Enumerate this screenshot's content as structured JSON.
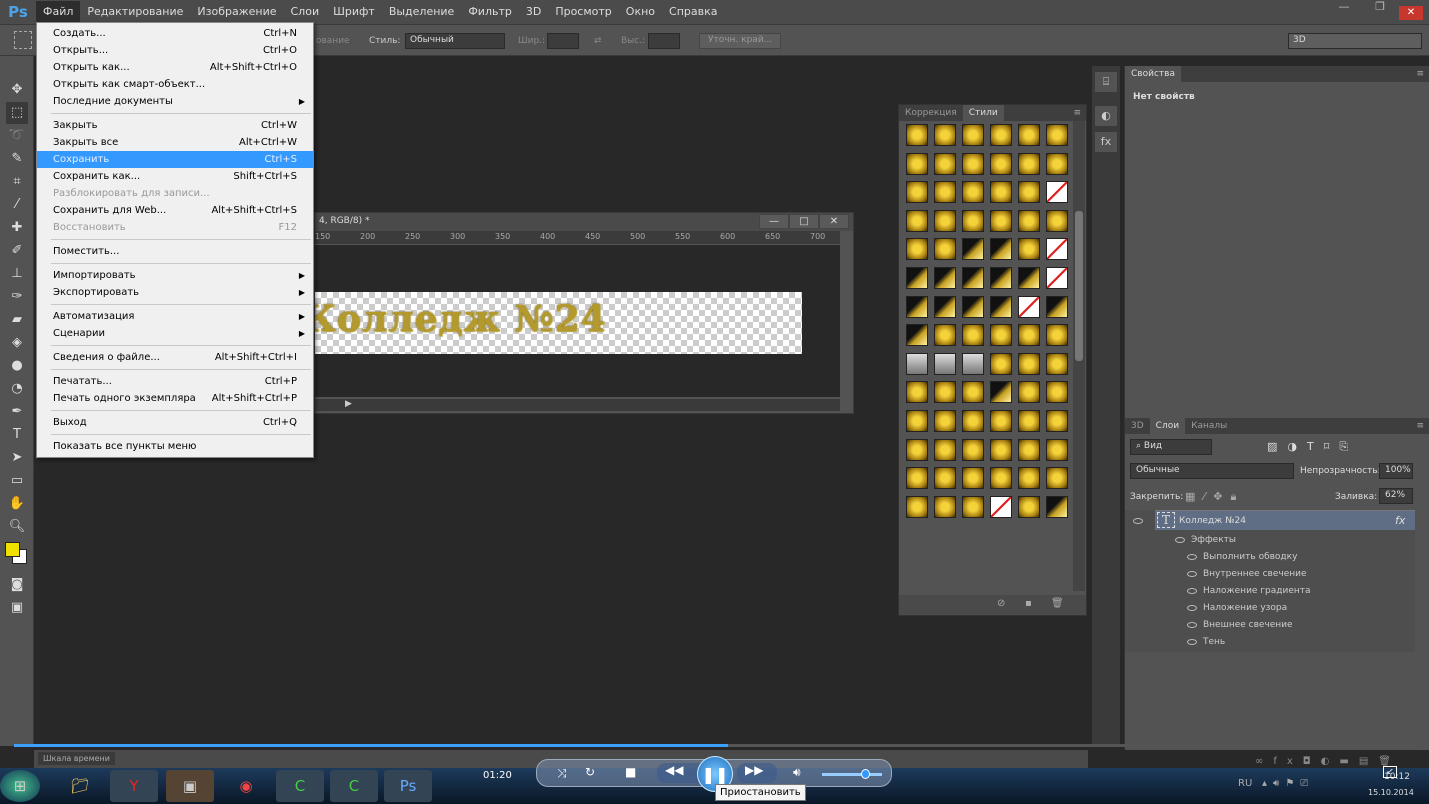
{
  "app": {
    "logo": "Ps"
  },
  "menubar": [
    "Файл",
    "Редактирование",
    "Изображение",
    "Слои",
    "Шрифт",
    "Выделение",
    "Фильтр",
    "3D",
    "Просмотр",
    "Окно",
    "Справка"
  ],
  "window_controls": {
    "minimize": "—",
    "restore": "❐",
    "close": "✕"
  },
  "options": {
    "mode_partial": "ование",
    "style_label": "Стиль:",
    "style_value": "Обычный",
    "width_label": "Шир.:",
    "height_label": "Выс.:",
    "refine_button": "Уточн. край...",
    "workspace": "3D"
  },
  "file_menu": [
    {
      "label": "Создать...",
      "shortcut": "Ctrl+N"
    },
    {
      "label": "Открыть...",
      "shortcut": "Ctrl+O"
    },
    {
      "label": "Открыть как...",
      "shortcut": "Alt+Shift+Ctrl+O"
    },
    {
      "label": "Открыть как смарт-объект...",
      "shortcut": ""
    },
    {
      "label": "Последние документы",
      "shortcut": "",
      "submenu": true
    },
    {
      "sep": true
    },
    {
      "label": "Закрыть",
      "shortcut": "Ctrl+W"
    },
    {
      "label": "Закрыть все",
      "shortcut": "Alt+Ctrl+W"
    },
    {
      "label": "Сохранить",
      "shortcut": "Ctrl+S",
      "highlight": true
    },
    {
      "label": "Сохранить как...",
      "shortcut": "Shift+Ctrl+S"
    },
    {
      "label": "Разблокировать для записи...",
      "shortcut": "",
      "disabled": true
    },
    {
      "label": "Сохранить для Web...",
      "shortcut": "Alt+Shift+Ctrl+S"
    },
    {
      "label": "Восстановить",
      "shortcut": "F12",
      "disabled": true
    },
    {
      "sep": true
    },
    {
      "label": "Поместить...",
      "shortcut": ""
    },
    {
      "sep": true
    },
    {
      "label": "Импортировать",
      "shortcut": "",
      "submenu": true
    },
    {
      "label": "Экспортировать",
      "shortcut": "",
      "submenu": true
    },
    {
      "sep": true
    },
    {
      "label": "Автоматизация",
      "shortcut": "",
      "submenu": true
    },
    {
      "label": "Сценарии",
      "shortcut": "",
      "submenu": true
    },
    {
      "sep": true
    },
    {
      "label": "Сведения о файле...",
      "shortcut": "Alt+Shift+Ctrl+I"
    },
    {
      "sep": true
    },
    {
      "label": "Печатать...",
      "shortcut": "Ctrl+P"
    },
    {
      "label": "Печать одного экземпляра",
      "shortcut": "Alt+Shift+Ctrl+P"
    },
    {
      "sep": true
    },
    {
      "label": "Выход",
      "shortcut": "Ctrl+Q"
    },
    {
      "sep": true
    },
    {
      "label": "Показать все пункты меню",
      "shortcut": ""
    }
  ],
  "document": {
    "title": "4, RGB/8) *",
    "ruler": [
      "150",
      "200",
      "250",
      "300",
      "350",
      "400",
      "450",
      "500",
      "550",
      "600",
      "650",
      "700"
    ],
    "text": "Колледж №24"
  },
  "styles_panel": {
    "tabs": [
      "Коррекция",
      "Стили"
    ],
    "active": "Стили"
  },
  "properties": {
    "tab": "Свойства",
    "empty": "Нет свойств"
  },
  "layers": {
    "tabs": [
      "3D",
      "Слои",
      "Каналы"
    ],
    "active": "Слои",
    "filter": "Вид",
    "blend": "Обычные",
    "opacity_label": "Непрозрачность:",
    "opacity": "100%",
    "lock_label": "Закрепить:",
    "fill_label": "Заливка:",
    "fill": "62%",
    "layer_name": "Колледж №24",
    "effects_label": "Эффекты",
    "effects": [
      "Выполнить обводку",
      "Внутреннее свечение",
      "Наложение градиента",
      "Наложение узора",
      "Внешнее свечение",
      "Тень"
    ]
  },
  "timeline": {
    "label": "Шкала времени"
  },
  "player": {
    "time": "01:20",
    "progress_percent": 51,
    "tooltip": "Приостановить"
  },
  "tray": {
    "lang": "RU",
    "time": "10:12",
    "date": "15.10.2014"
  },
  "colors": {
    "foreground": "#f0e000",
    "background": "#ffffff",
    "highlight": "#3399ff",
    "accent": "#3ba0ff"
  }
}
